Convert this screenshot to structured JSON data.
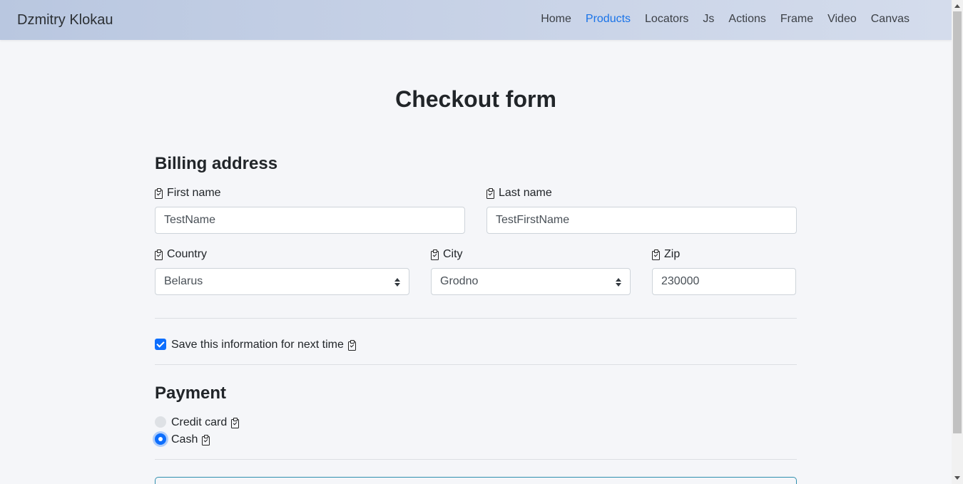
{
  "navbar": {
    "brand": "Dzmitry Klokau",
    "links": [
      {
        "label": "Home",
        "active": false
      },
      {
        "label": "Products",
        "active": true
      },
      {
        "label": "Locators",
        "active": false
      },
      {
        "label": "Js",
        "active": false
      },
      {
        "label": "Actions",
        "active": false
      },
      {
        "label": "Frame",
        "active": false
      },
      {
        "label": "Video",
        "active": false
      },
      {
        "label": "Canvas",
        "active": false
      }
    ],
    "active_color": "#1a73e8"
  },
  "page": {
    "title": "Checkout form"
  },
  "billing": {
    "title": "Billing address",
    "first_name": {
      "label": "First name",
      "value": "TestName"
    },
    "last_name": {
      "label": "Last name",
      "value": "TestFirstName"
    },
    "country": {
      "label": "Country",
      "value": "Belarus"
    },
    "city": {
      "label": "City",
      "value": "Grodno"
    },
    "zip": {
      "label": "Zip",
      "value": "230000"
    }
  },
  "save_info": {
    "label": "Save this information for next time",
    "checked": true
  },
  "payment": {
    "title": "Payment",
    "options": [
      {
        "label": "Credit card",
        "selected": false
      },
      {
        "label": "Cash",
        "selected": true
      }
    ]
  },
  "icons": {
    "field_label_icon": "clipboard-check-icon"
  }
}
